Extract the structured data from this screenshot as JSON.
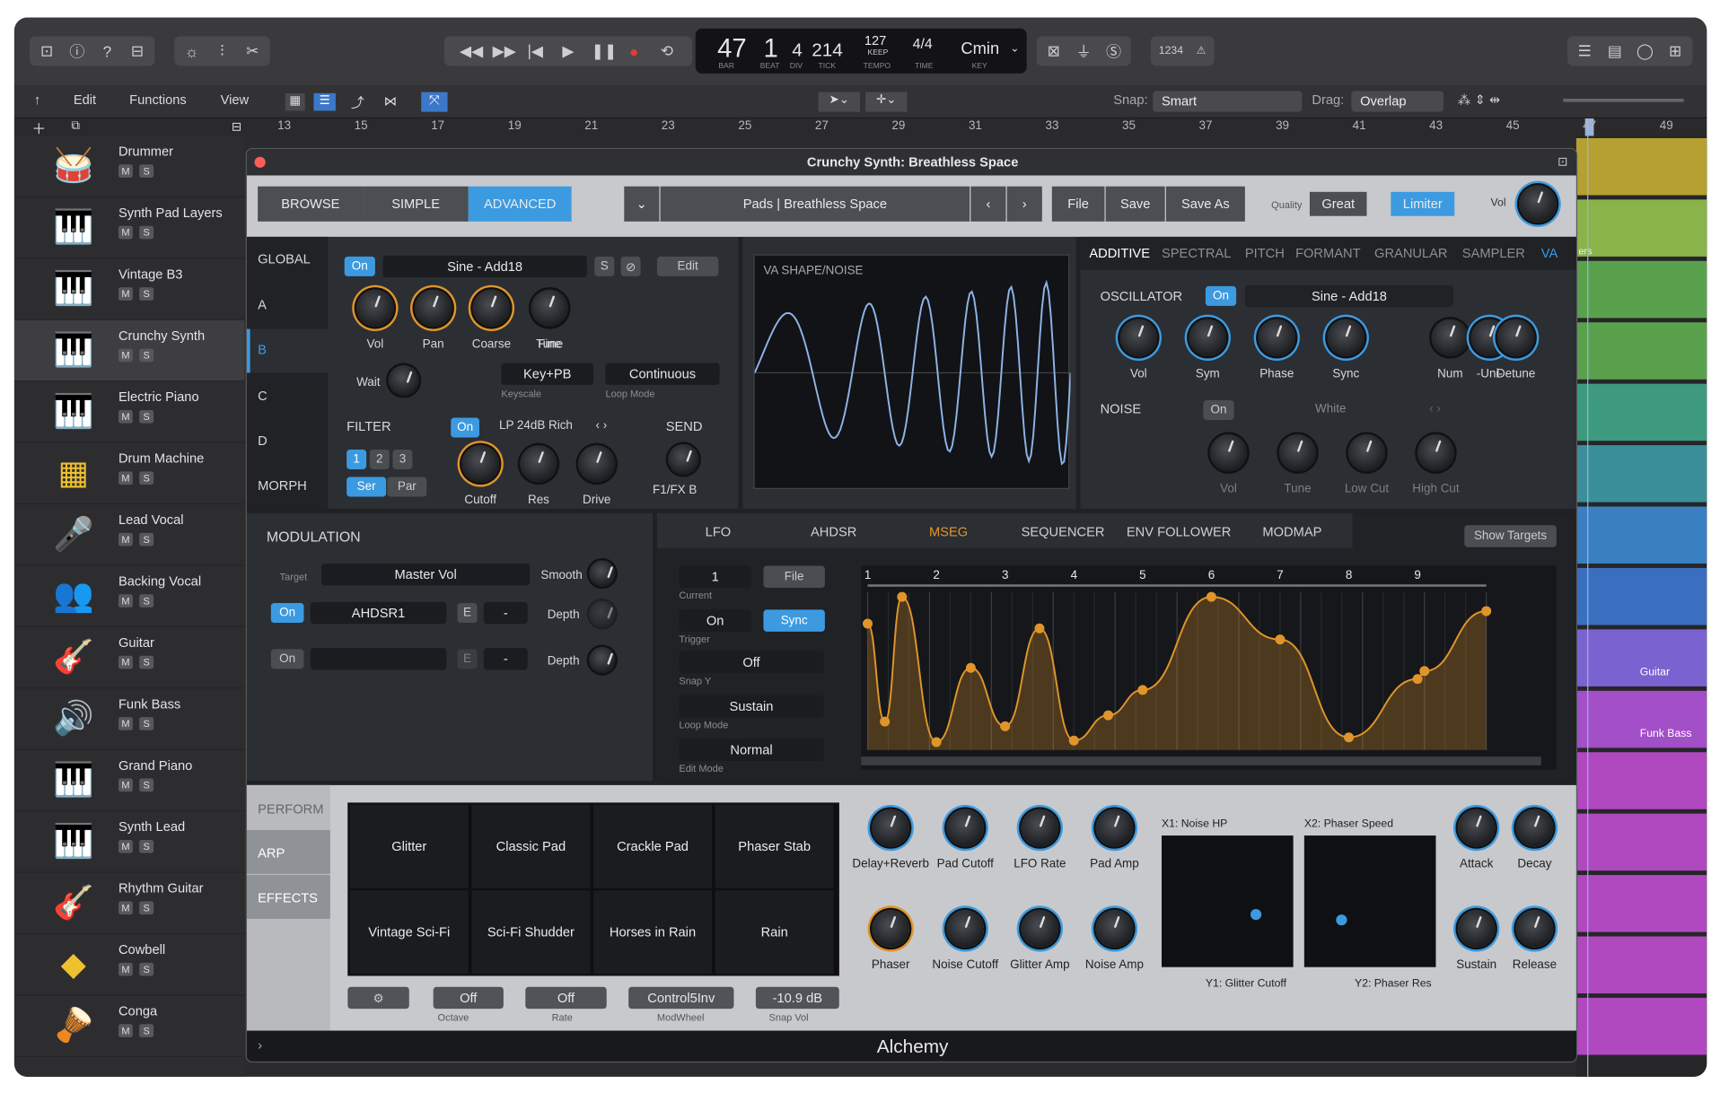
{
  "transport": {
    "bar": "47",
    "beat": "1",
    "div": "4",
    "tick": "214",
    "tempo": "127",
    "tempo_mode": "KEEP",
    "sig": "4/4",
    "key": "Cmin",
    "l_bar": "BAR",
    "l_beat": "BEAT",
    "l_div": "DIV",
    "l_tick": "TICK",
    "l_tempo": "TEMPO",
    "l_time": "TIME",
    "l_key": "KEY",
    "counter": "1234"
  },
  "menus": {
    "edit": "Edit",
    "functions": "Functions",
    "view": "View",
    "snap_label": "Snap:",
    "snap": "Smart",
    "drag_label": "Drag:",
    "drag": "Overlap"
  },
  "ruler": [
    "13",
    "15",
    "17",
    "19",
    "21",
    "23",
    "25",
    "27",
    "29",
    "31",
    "33",
    "35",
    "37",
    "39",
    "41",
    "43",
    "45",
    "47",
    "49"
  ],
  "tracks": [
    {
      "name": "Drummer"
    },
    {
      "name": "Synth Pad Layers"
    },
    {
      "name": "Vintage B3"
    },
    {
      "name": "Crunchy Synth"
    },
    {
      "name": "Electric Piano"
    },
    {
      "name": "Drum Machine"
    },
    {
      "name": "Lead Vocal"
    },
    {
      "name": "Backing Vocal"
    },
    {
      "name": "Guitar"
    },
    {
      "name": "Funk Bass"
    },
    {
      "name": "Grand Piano"
    },
    {
      "name": "Synth Lead"
    },
    {
      "name": "Rhythm Guitar"
    },
    {
      "name": "Cowbell"
    },
    {
      "name": "Conga"
    }
  ],
  "ms": {
    "m": "M",
    "s": "S"
  },
  "regions": {
    "guitar": "Guitar",
    "funk_bass": "Funk Bass",
    "ers": "ers"
  },
  "plugin": {
    "title": "Crunchy Synth: Breathless Space",
    "browse": "BROWSE",
    "simple": "SIMPLE",
    "advanced": "ADVANCED",
    "preset": "Pads | Breathless Space",
    "file": "File",
    "save": "Save",
    "save_as": "Save As",
    "quality_label": "Quality",
    "quality": "Great",
    "limiter": "Limiter",
    "vol": "Vol",
    "footer": "Alchemy"
  },
  "left_tabs": {
    "global": "GLOBAL",
    "a": "A",
    "b": "B",
    "c": "C",
    "d": "D",
    "morph": "MORPH"
  },
  "source": {
    "on": "On",
    "osc": "Sine - Add18",
    "s": "S",
    "edit": "Edit",
    "knobs": [
      "Vol",
      "Pan",
      "Coarse",
      "Tune",
      "Fine"
    ],
    "wait": "Wait",
    "keyscale": "Key+PB",
    "keyscale_label": "Keyscale",
    "loop": "Continuous",
    "loop_label": "Loop Mode"
  },
  "filter": {
    "title": "FILTER",
    "on": "On",
    "type": "LP 24dB Rich",
    "n1": "1",
    "n2": "2",
    "n3": "3",
    "ser": "Ser",
    "par": "Par",
    "knobs": [
      "Cutoff",
      "Res",
      "Drive"
    ],
    "send": "SEND",
    "send_val": "F1/FX B"
  },
  "wave": {
    "title": "VA SHAPE/NOISE"
  },
  "synth_tabs": [
    "ADDITIVE",
    "SPECTRAL",
    "PITCH",
    "FORMANT",
    "GRANULAR",
    "SAMPLER",
    "VA"
  ],
  "oscillator": {
    "title": "OSCILLATOR",
    "on": "On",
    "wave": "Sine - Add18",
    "knobs": [
      "Vol",
      "Sym",
      "Phase",
      "Sync",
      "Num",
      "-Uni-",
      "Detune"
    ]
  },
  "noise": {
    "title": "NOISE",
    "on": "On",
    "type": "White",
    "knobs": [
      "Vol",
      "Tune",
      "Low Cut",
      "High Cut"
    ]
  },
  "modulation": {
    "title": "MODULATION",
    "target_label": "Target",
    "target": "Master Vol",
    "smooth": "Smooth",
    "on1": "On",
    "src1": "AHDSR1",
    "e": "E",
    "dash": "-",
    "depth": "Depth",
    "on2": "On"
  },
  "mod_tabs": [
    "LFO",
    "AHDSR",
    "MSEG",
    "SEQUENCER",
    "ENV FOLLOWER",
    "MODMAP"
  ],
  "show_targets": "Show Targets",
  "mseg": {
    "current": "1",
    "current_label": "Current",
    "file": "File",
    "trigger": "On",
    "trigger_label": "Trigger",
    "sync": "Sync",
    "snapy": "Off",
    "snapy_label": "Snap Y",
    "loop": "Sustain",
    "loop_label": "Loop Mode",
    "edit": "Normal",
    "edit_label": "Edit Mode",
    "steps": [
      "1",
      "2",
      "3",
      "4",
      "5",
      "6",
      "7",
      "8",
      "9"
    ]
  },
  "chart_data": {
    "type": "line",
    "x": [
      0,
      0.25,
      0.5,
      1,
      1.5,
      2,
      2.5,
      3,
      3.5,
      4,
      5,
      6,
      7,
      8,
      8.1,
      9
    ],
    "y": [
      0.8,
      0.18,
      0.97,
      0.05,
      0.52,
      0.15,
      0.77,
      0.06,
      0.22,
      0.38,
      0.97,
      0.7,
      0.08,
      0.45,
      0.5,
      0.88
    ],
    "xlim": [
      0,
      9
    ],
    "ylim": [
      0,
      1
    ]
  },
  "perform": {
    "perform": "PERFORM",
    "arp": "ARP",
    "effects": "EFFECTS",
    "pads": [
      "Glitter",
      "Classic Pad",
      "Crackle Pad",
      "Phaser Stab",
      "Vintage Sci-Fi",
      "Sci-Fi Shudder",
      "Horses in Rain",
      "Rain"
    ],
    "octave": "Off",
    "octave_label": "Octave",
    "rate": "Off",
    "rate_label": "Rate",
    "modwheel": "Control5Inv",
    "modwheel_label": "ModWheel",
    "snapvol": "-10.9 dB",
    "snapvol_label": "Snap Vol"
  },
  "macros": {
    "row1": [
      "Delay+Reverb",
      "Pad Cutoff",
      "LFO Rate",
      "Pad Amp"
    ],
    "row2": [
      "Phaser",
      "Noise Cutoff",
      "Glitter Amp",
      "Noise Amp"
    ]
  },
  "xy": {
    "x1": "X1: Noise HP",
    "y1": "Y1: Glitter Cutoff",
    "x2": "X2: Phaser Speed",
    "y2": "Y2: Phaser Res",
    "p1": [
      0.72,
      0.6
    ],
    "p2": [
      0.28,
      0.64
    ]
  },
  "env": [
    "Attack",
    "Decay",
    "Sustain",
    "Release"
  ],
  "colors": {
    "accent": "#3c9ae0",
    "mseg": "#e0952a"
  }
}
